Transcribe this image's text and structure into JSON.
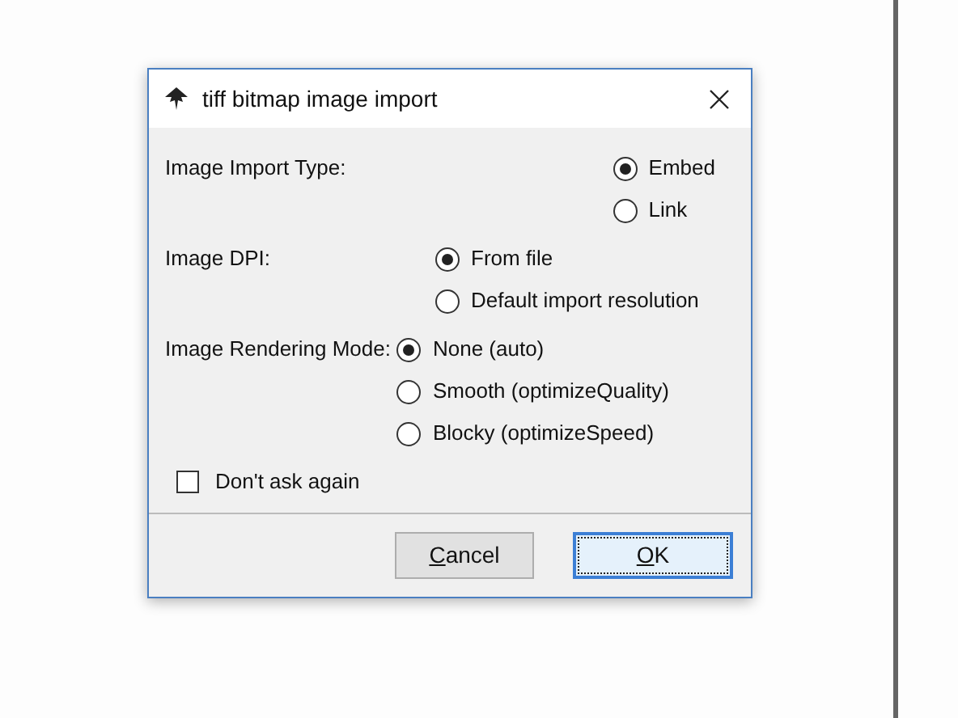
{
  "dialog": {
    "title": "tiff bitmap image import"
  },
  "groups": [
    {
      "kind": "right",
      "label": "Image Import Type:",
      "options": [
        {
          "label": "Embed",
          "selected": true
        },
        {
          "label": "Link",
          "selected": false
        }
      ]
    },
    {
      "kind": "middle",
      "label": "Image DPI:",
      "options": [
        {
          "label": "From file",
          "selected": true
        },
        {
          "label": "Default import resolution",
          "selected": false
        }
      ]
    },
    {
      "kind": "inline",
      "label": "Image Rendering Mode:",
      "options": [
        {
          "label": "None (auto)",
          "selected": true
        },
        {
          "label": "Smooth (optimizeQuality)",
          "selected": false
        },
        {
          "label": "Blocky (optimizeSpeed)",
          "selected": false
        }
      ]
    }
  ],
  "dont_ask": {
    "label": "Don't ask again",
    "checked": false
  },
  "buttons": [
    {
      "label": "Cancel",
      "underline_first": true,
      "focused": false
    },
    {
      "label": "OK",
      "underline_first": true,
      "focused": true
    }
  ]
}
